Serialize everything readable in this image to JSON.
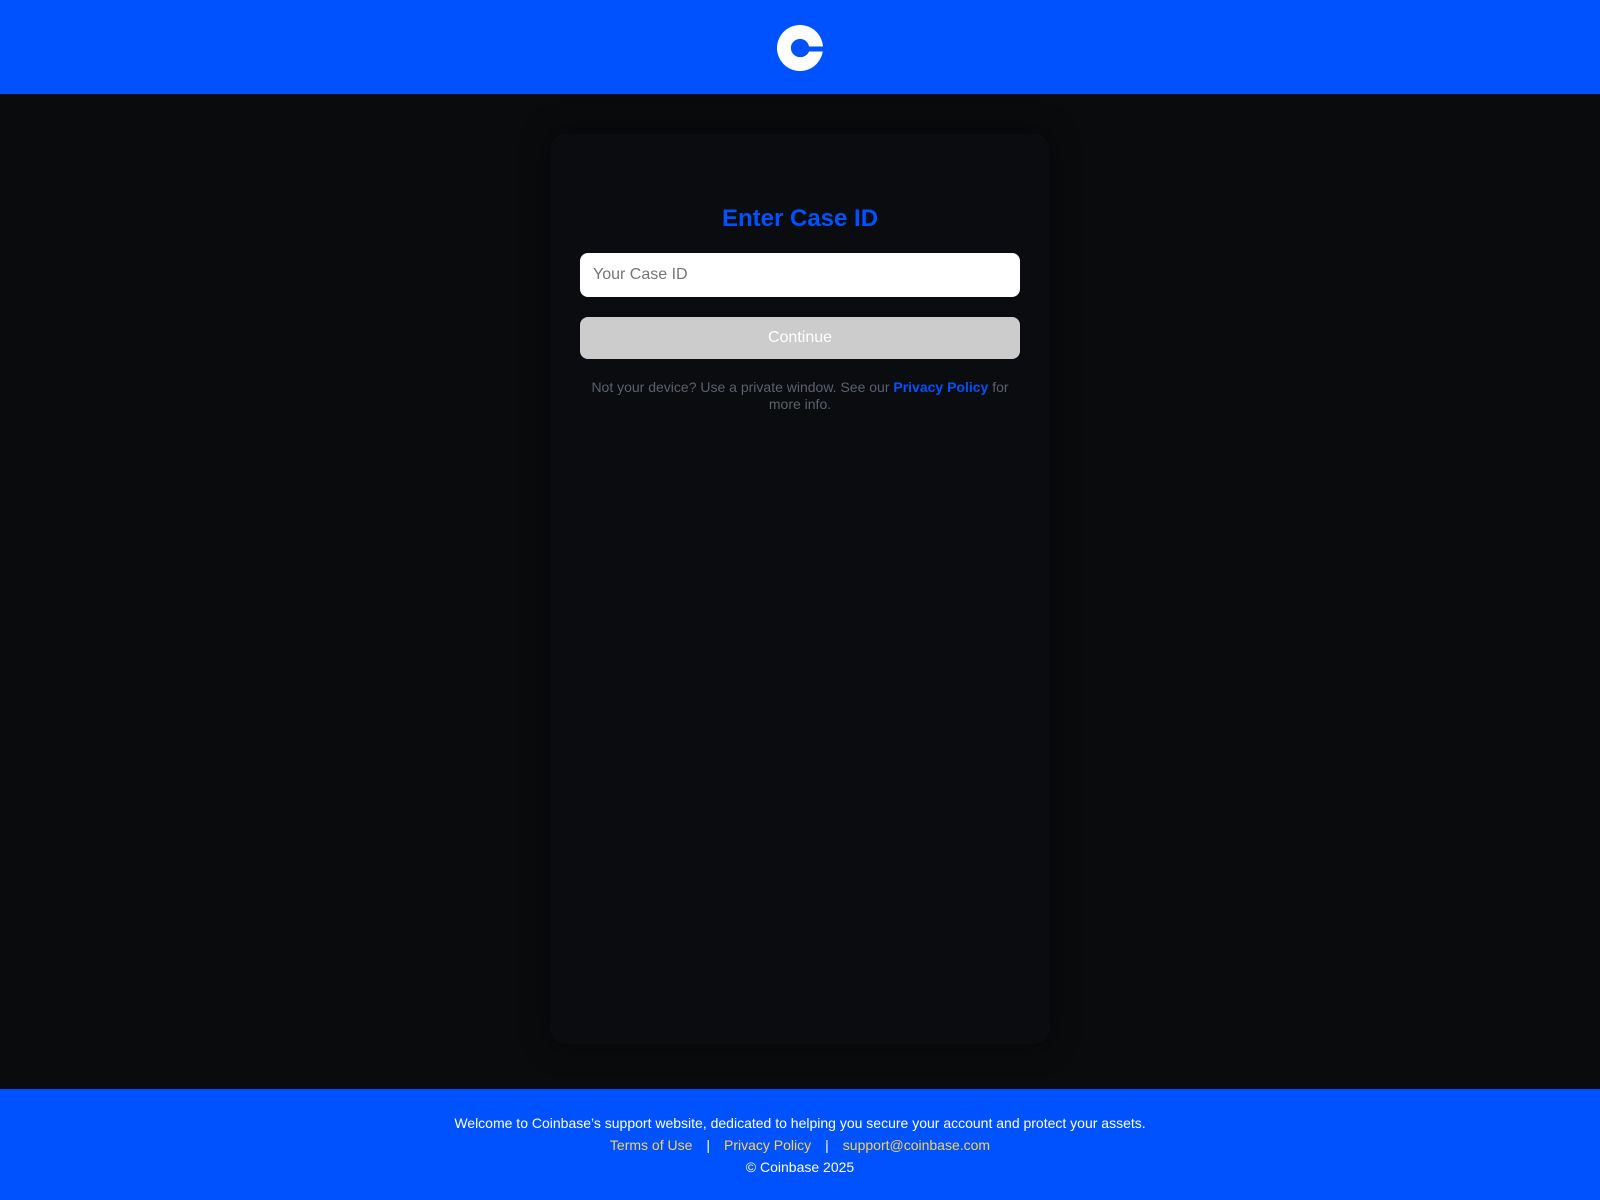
{
  "header": {
    "logo_icon": "coinbase-logo-icon",
    "brand_color": "#0052ff"
  },
  "form": {
    "title": "Enter Case ID",
    "case_id_placeholder": "Your Case ID",
    "case_id_value": "",
    "continue_label": "Continue",
    "note_prefix": "Not your device? Use a private window. See our ",
    "note_link": "Privacy Policy",
    "note_suffix": " for more info."
  },
  "footer": {
    "welcome": "Welcome to Coinbase’s support website, dedicated to helping you secure your account and protect your assets.",
    "links": {
      "terms": "Terms of Use",
      "privacy": "Privacy Policy",
      "email": "support@coinbase.com"
    },
    "separator": "|",
    "copyright": "© Coinbase 2025",
    "link_color": "#f4d35e"
  }
}
